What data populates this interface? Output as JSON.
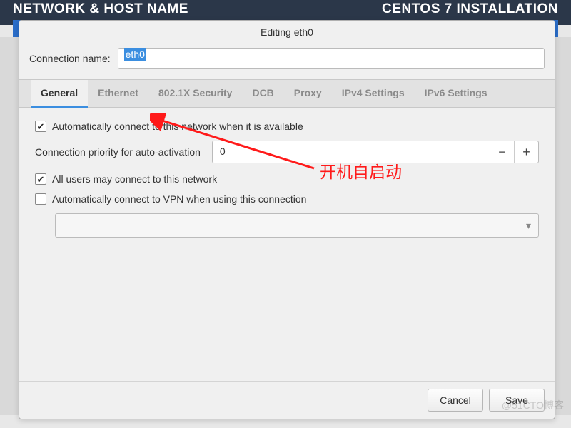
{
  "header": {
    "left": "NETWORK & HOST NAME",
    "right": "CENTOS 7 INSTALLATION"
  },
  "dialog": {
    "title": "Editing eth0",
    "connection_name_label": "Connection name:",
    "connection_name_value": "eth0"
  },
  "tabs": [
    "General",
    "Ethernet",
    "802.1X Security",
    "DCB",
    "Proxy",
    "IPv4 Settings",
    "IPv6 Settings"
  ],
  "general": {
    "auto_connect_label": "Automatically connect to this network when it is available",
    "auto_connect_checked": true,
    "priority_label": "Connection priority for auto-activation",
    "priority_value": "0",
    "all_users_label": "All users may connect to this network",
    "all_users_checked": true,
    "auto_vpn_label": "Automatically connect to VPN when using this connection",
    "auto_vpn_checked": false
  },
  "footer": {
    "cancel": "Cancel",
    "save": "Save"
  },
  "annotation": {
    "text": "开机自启动"
  },
  "watermark": "@51CTO博客"
}
